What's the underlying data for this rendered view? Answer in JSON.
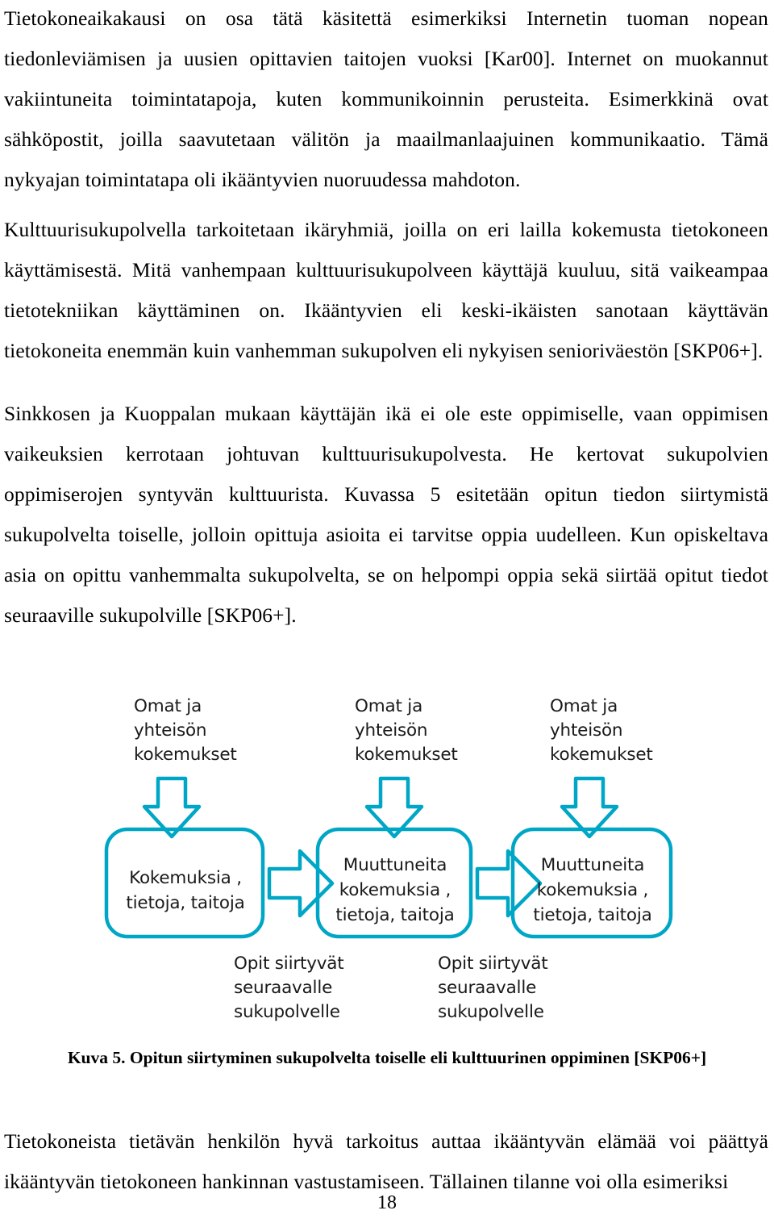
{
  "document": {
    "page_number": "18",
    "language": "fi"
  },
  "paragraphs": {
    "p1": "Tietokoneaikakausi on osa tätä käsitettä esimerkiksi Internetin tuoman nopean tiedonleviämisen ja uusien opittavien taitojen vuoksi [Kar00]. Internet on muokannut vakiintuneita toimintatapoja, kuten kommunikoinnin perusteita. Esimerkkinä ovat sähköpostit, joilla saavutetaan välitön ja maailmanlaajuinen kommunikaatio. Tämä nykyajan toimintatapa oli ikääntyvien nuoruudessa mahdoton.",
    "p2": "Kulttuurisukupolvella tarkoitetaan ikäryhmiä, joilla on eri lailla kokemusta tietokoneen käyttämisestä. Mitä vanhempaan kulttuurisukupolveen käyttäjä kuuluu, sitä vaikeampaa tietotekniikan käyttäminen on. Ikääntyvien eli keski-ikäisten sanotaan käyttävän tietokoneita enemmän kuin vanhemman sukupolven eli nykyisen senioriväestön [SKP06+].",
    "p3": "Sinkkosen ja Kuoppalan mukaan käyttäjän ikä ei ole este oppimiselle, vaan oppimisen vaikeuksien kerrotaan johtuvan kulttuurisukupolvesta. He kertovat sukupolvien oppimiserojen syntyvän kulttuurista. Kuvassa 5 esitetään opitun tiedon siirtymistä sukupolvelta toiselle, jolloin opittuja asioita ei tarvitse oppia uudelleen. Kun opiskeltava asia on opittu vanhemmalta sukupolvelta, se on helpompi oppia sekä siirtää opitut tiedot seuraaville sukupolville [SKP06+].",
    "p4": "Tietokoneista tietävän henkilön hyvä tarkoitus auttaa ikääntyvän elämää voi päättyä ikääntyvän tietokoneen hankinnan vastustamiseen. Tällainen tilanne voi olla esimeriksi"
  },
  "figure": {
    "caption": "Kuva 5. Opitun siirtyminen sukupolvelta toiselle eli kulttuurinen oppiminen [SKP06+]",
    "accent_color": "#00A6C6",
    "box_fill": "#FFFFFF",
    "text_color": "#1A1A1A",
    "columns": [
      {
        "header": "Omat ja\nyhteisön\nkokemukset",
        "box": "Kokemuksia ,\ntietoja, taitoja"
      },
      {
        "header": "Omat ja\nyhteisön\nkokemukset",
        "box": "Muuttuneita\nkokemuksia ,\ntietoja, taitoja"
      },
      {
        "header": "Omat ja\nyhteisön\nkokemukset",
        "box": "Muuttuneita\nkokemuksia ,\ntietoja, taitoja"
      }
    ],
    "transfer_labels": [
      "Opit siirtyvät\nseuraavalle\nsukupolvelle",
      "Opit siirtyvät\nseuraavalle\nsukupolvelle"
    ]
  }
}
